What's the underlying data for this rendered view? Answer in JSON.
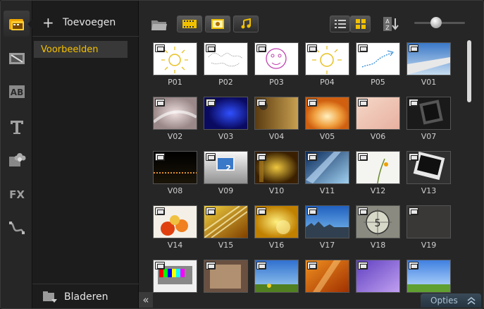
{
  "rail": {
    "items": [
      {
        "name": "media-library",
        "icon": "media-folder-icon",
        "active": true
      },
      {
        "name": "transitions",
        "icon": "transition-film-icon"
      },
      {
        "name": "titles-ab",
        "icon": "ab-icon"
      },
      {
        "name": "text",
        "icon": "text-t-icon"
      },
      {
        "name": "graphics",
        "icon": "graphics-flower-icon"
      },
      {
        "name": "filters",
        "icon": "fx-icon"
      },
      {
        "name": "motion-path",
        "icon": "path-icon"
      }
    ],
    "fx_label": "FX",
    "ab_label": "AB"
  },
  "sidebar": {
    "add_label": "Toevoegen",
    "items": [
      {
        "label": "Voorbeelden",
        "selected": true
      }
    ],
    "browse_label": "Bladeren"
  },
  "toolbar": {
    "filters": [
      "video-filter",
      "photo-filter",
      "audio-filter"
    ],
    "view": "thumbnail"
  },
  "grid": {
    "items": [
      {
        "label": "P01",
        "kind": "photo"
      },
      {
        "label": "P02",
        "kind": "photo"
      },
      {
        "label": "P03",
        "kind": "photo"
      },
      {
        "label": "P04",
        "kind": "photo"
      },
      {
        "label": "P05",
        "kind": "photo"
      },
      {
        "label": "V01",
        "kind": "video"
      },
      {
        "label": "V02",
        "kind": "video"
      },
      {
        "label": "V03",
        "kind": "video"
      },
      {
        "label": "V04",
        "kind": "video"
      },
      {
        "label": "V05",
        "kind": "video"
      },
      {
        "label": "V06",
        "kind": "video"
      },
      {
        "label": "V07",
        "kind": "video"
      },
      {
        "label": "V08",
        "kind": "video"
      },
      {
        "label": "V09",
        "kind": "video"
      },
      {
        "label": "V10",
        "kind": "video"
      },
      {
        "label": "V11",
        "kind": "video"
      },
      {
        "label": "V12",
        "kind": "video"
      },
      {
        "label": "V13",
        "kind": "video"
      },
      {
        "label": "V14",
        "kind": "video"
      },
      {
        "label": "V15",
        "kind": "video"
      },
      {
        "label": "V16",
        "kind": "video"
      },
      {
        "label": "V17",
        "kind": "video"
      },
      {
        "label": "V18",
        "kind": "video"
      },
      {
        "label": "V19",
        "kind": "video"
      },
      {
        "label": "",
        "kind": "video"
      },
      {
        "label": "",
        "kind": "video"
      },
      {
        "label": "",
        "kind": "video"
      },
      {
        "label": "",
        "kind": "video"
      },
      {
        "label": "",
        "kind": "video"
      },
      {
        "label": "",
        "kind": "video"
      }
    ],
    "v09_number": "2",
    "v18_number": "5"
  },
  "bottom": {
    "options_label": "Opties",
    "collapse_glyph": "«"
  },
  "colors": {
    "accent": "#f5c000",
    "selected_bg": "#383838"
  }
}
